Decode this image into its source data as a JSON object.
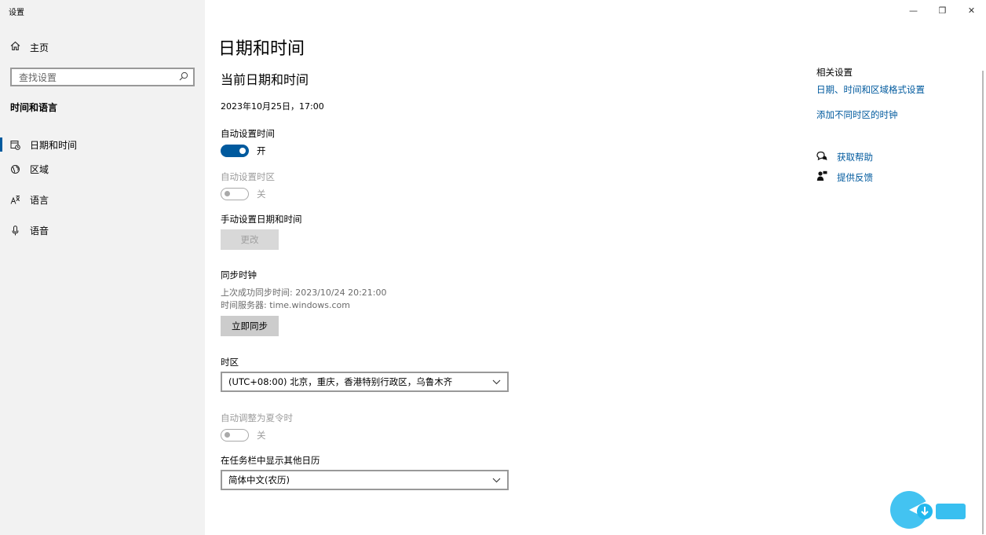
{
  "app": {
    "title": "设置"
  },
  "window_controls": {
    "minimize": "—",
    "restore": "❐",
    "close": "✕"
  },
  "sidebar": {
    "home_label": "主页",
    "search_placeholder": "查找设置",
    "section_title": "时间和语言",
    "items": [
      {
        "label": "日期和时间",
        "icon": "calendar-clock-icon",
        "active": true
      },
      {
        "label": "区域",
        "icon": "globe-region-icon",
        "active": false
      },
      {
        "label": "语言",
        "icon": "language-icon",
        "active": false
      },
      {
        "label": "语音",
        "icon": "microphone-icon",
        "active": false
      }
    ]
  },
  "main": {
    "page_title": "日期和时间",
    "sub_title": "当前日期和时间",
    "current_datetime": "2023年10月25日，17:00",
    "auto_time": {
      "label": "自动设置时间",
      "state": "开",
      "on": true
    },
    "auto_timezone": {
      "label": "自动设置时区",
      "state": "关",
      "on": false,
      "disabled": true
    },
    "manual": {
      "label": "手动设置日期和时间",
      "button": "更改"
    },
    "sync": {
      "label": "同步时钟",
      "last_sync": "上次成功同步时间: 2023/10/24 20:21:00",
      "server": "时间服务器: time.windows.com",
      "button": "立即同步"
    },
    "timezone": {
      "label": "时区",
      "value": "(UTC+08:00) 北京，重庆，香港特别行政区，乌鲁木齐"
    },
    "dst": {
      "label": "自动调整为夏令时",
      "state": "关",
      "on": false,
      "disabled": true
    },
    "calendar": {
      "label": "在任务栏中显示其他日历",
      "value": "简体中文(农历)"
    }
  },
  "related": {
    "title": "相关设置",
    "links": [
      "日期、时间和区域格式设置",
      "添加不同时区的时钟"
    ],
    "help": "获取帮助",
    "feedback": "提供反馈"
  },
  "colors": {
    "accent": "#005a9e",
    "sidebar_bg": "#f2f2f2",
    "button_bg": "#cccccc"
  }
}
